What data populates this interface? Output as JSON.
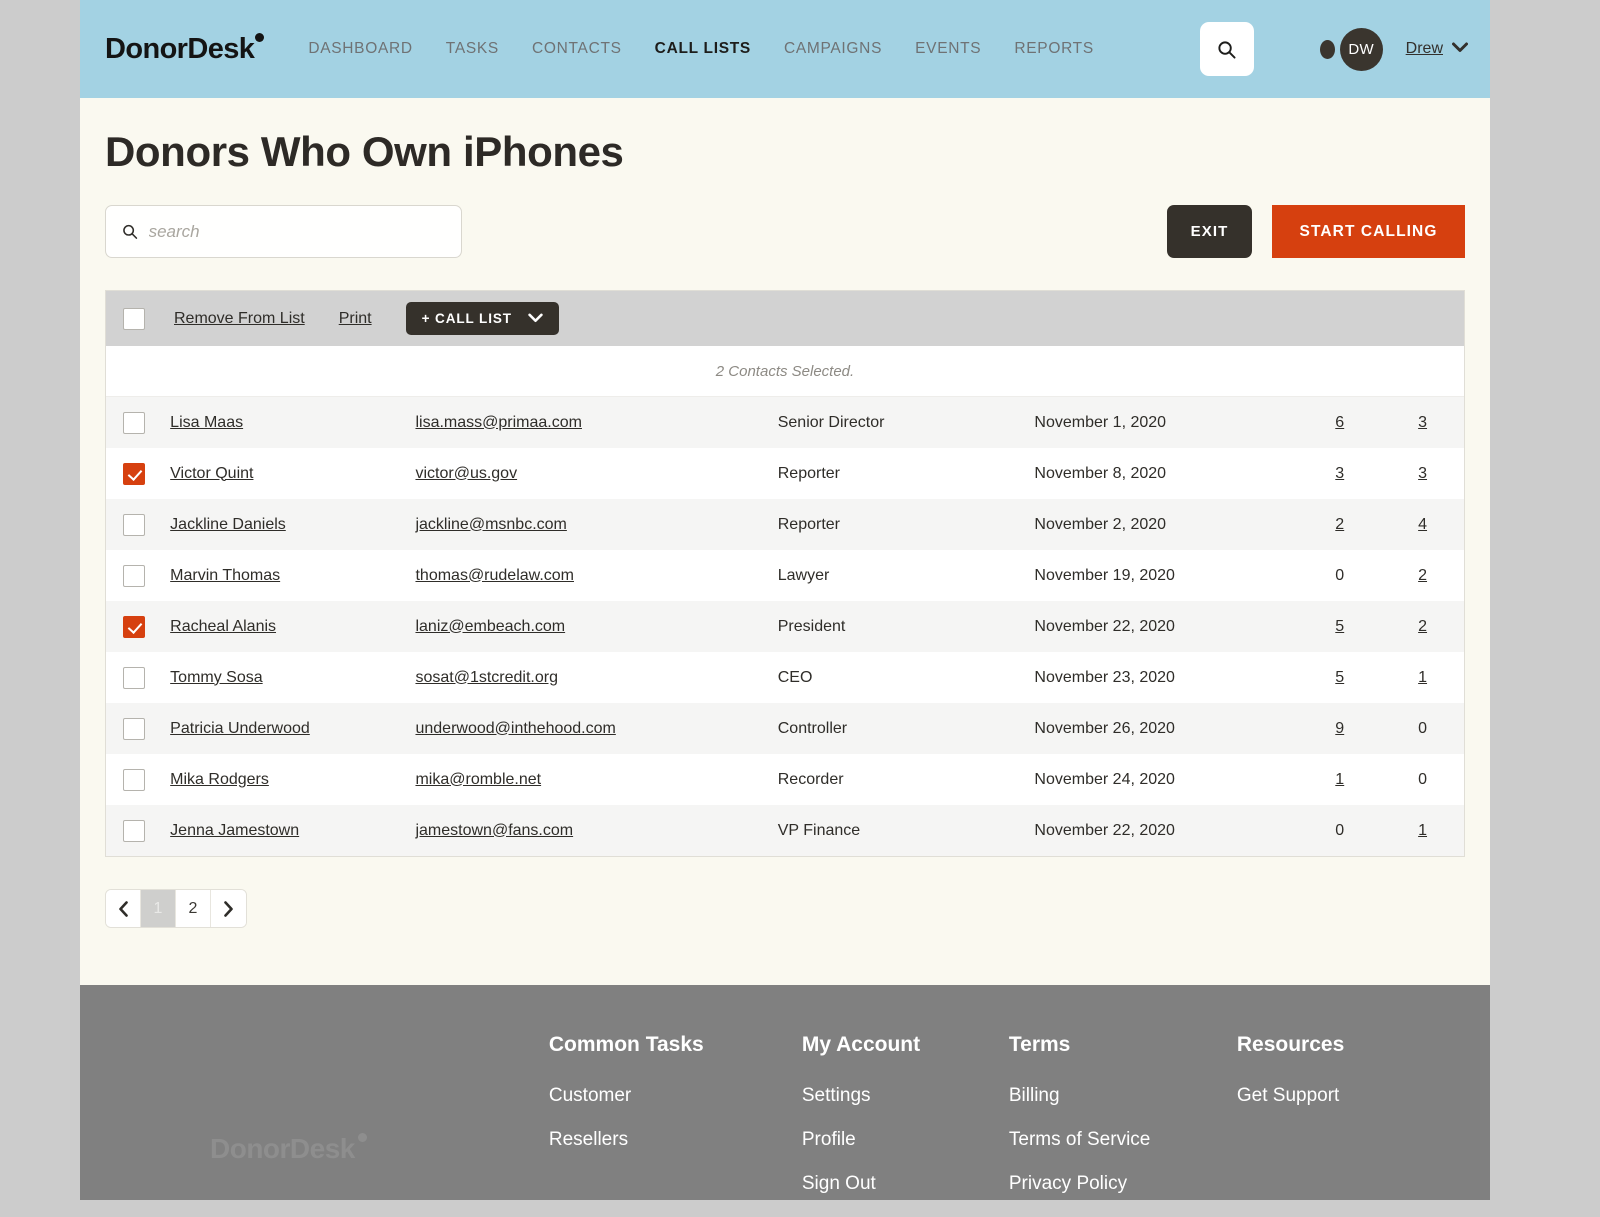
{
  "brand": {
    "name": "DonorDesk"
  },
  "nav": {
    "items": [
      {
        "label": "DASHBOARD",
        "active": false
      },
      {
        "label": "TASKS",
        "active": false
      },
      {
        "label": "CONTACTS",
        "active": false
      },
      {
        "label": "CALL LISTS",
        "active": true
      },
      {
        "label": "CAMPAIGNS",
        "active": false
      },
      {
        "label": "EVENTS",
        "active": false
      },
      {
        "label": "REPORTS",
        "active": false
      }
    ]
  },
  "account": {
    "search_icon": "search-icon",
    "notification_icon": "notification-dot-icon",
    "avatar_initials": "DW",
    "username": "Drew",
    "caret_icon": "chevron-down-icon"
  },
  "page": {
    "title": "Donors Who Own iPhones"
  },
  "search": {
    "placeholder": "search",
    "value": "",
    "icon": "search-icon"
  },
  "actions": {
    "exit_label": "EXIT",
    "start_calling_label": "START CALLING"
  },
  "toolbar": {
    "select_all_checked": false,
    "remove_label": "Remove From List",
    "print_label": "Print",
    "call_list_label": "+ CALL LIST",
    "call_list_caret": "chevron-down-icon"
  },
  "table": {
    "selection_note": "2 Contacts Selected.",
    "rows": [
      {
        "checked": false,
        "name": "Lisa Maas",
        "email": "lisa.mass@primaa.com",
        "title": "Senior Director",
        "date": "November 1, 2020",
        "n1": "6",
        "n2": "3"
      },
      {
        "checked": true,
        "name": "Victor Quint",
        "email": "victor@us.gov",
        "title": "Reporter",
        "date": "November 8, 2020",
        "n1": "3",
        "n2": "3"
      },
      {
        "checked": false,
        "name": "Jackline Daniels",
        "email": "jackline@msnbc.com",
        "title": "Reporter",
        "date": "November 2, 2020",
        "n1": "2",
        "n2": "4"
      },
      {
        "checked": false,
        "name": "Marvin Thomas",
        "email": "thomas@rudelaw.com",
        "title": "Lawyer",
        "date": "November 19, 2020",
        "n1": "0",
        "n2": "2"
      },
      {
        "checked": true,
        "name": "Racheal Alanis",
        "email": "laniz@embeach.com",
        "title": "President",
        "date": "November 22, 2020",
        "n1": "5",
        "n2": "2"
      },
      {
        "checked": false,
        "name": "Tommy Sosa",
        "email": "sosat@1stcredit.org",
        "title": "CEO",
        "date": "November 23, 2020",
        "n1": "5",
        "n2": "1"
      },
      {
        "checked": false,
        "name": "Patricia Underwood",
        "email": "underwood@inthehood.com",
        "title": "Controller",
        "date": "November 26, 2020",
        "n1": "9",
        "n2": "0"
      },
      {
        "checked": false,
        "name": "Mika Rodgers",
        "email": "mika@romble.net",
        "title": "Recorder",
        "date": "November 24, 2020",
        "n1": "1",
        "n2": "0"
      },
      {
        "checked": false,
        "name": "Jenna Jamestown",
        "email": "jamestown@fans.com",
        "title": "VP Finance",
        "date": "November 22, 2020",
        "n1": "0",
        "n2": "1"
      }
    ]
  },
  "pagination": {
    "prev_icon": "chevron-left-icon",
    "next_icon": "chevron-right-icon",
    "pages": [
      {
        "label": "1",
        "active": true
      },
      {
        "label": "2",
        "active": false
      }
    ]
  },
  "footer": {
    "logo": "DonorDesk",
    "columns": [
      {
        "heading": "Common Tasks",
        "links": [
          "Customer",
          "Resellers"
        ]
      },
      {
        "heading": "My Account",
        "links": [
          "Settings",
          "Profile",
          "Sign Out"
        ]
      },
      {
        "heading": "Terms",
        "links": [
          "Billing",
          "Terms of Service",
          "Privacy Policy"
        ]
      },
      {
        "heading": "Resources",
        "links": [
          "Get Support"
        ]
      }
    ]
  },
  "colors": {
    "header_blue": "#a3d2e3",
    "accent_orange": "#d6400f",
    "dark": "#35312b",
    "page_bg": "#faf9f0",
    "footer_gray": "#808080"
  }
}
